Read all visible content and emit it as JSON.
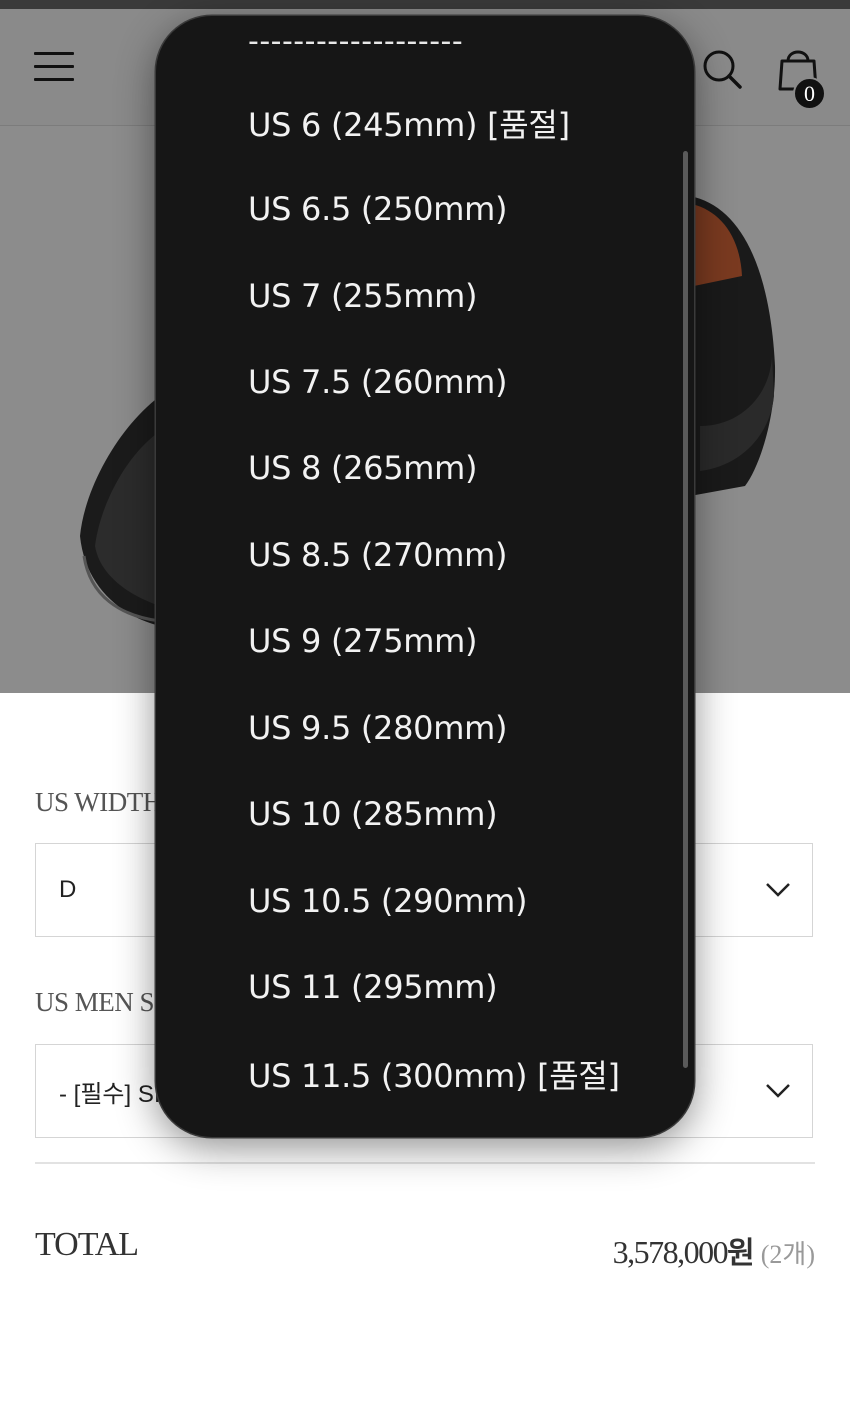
{
  "header": {
    "cart_count": "0"
  },
  "options": {
    "width": {
      "label": "US WIDTH",
      "value": "D"
    },
    "size": {
      "label": "US MEN SIZE",
      "value": "- [필수] SIZE"
    }
  },
  "total": {
    "label": "TOTAL",
    "amount": "3,578,000",
    "currency": "원",
    "quantity": "(2개)"
  },
  "picker": {
    "separator": "-------------------",
    "items": [
      "US 6 (245mm) [품절]",
      "US 6.5 (250mm)",
      "US 7 (255mm)",
      "US 7.5 (260mm)",
      "US 8 (265mm)",
      "US 8.5 (270mm)",
      "US 9 (275mm)",
      "US 9.5 (280mm)",
      "US 10 (285mm)",
      "US 10.5 (290mm)",
      "US 11 (295mm)",
      "US 11.5 (300mm) [품절]"
    ]
  },
  "icons": [
    "menu-icon",
    "search-icon",
    "shopping-bag-icon",
    "chevron-down-icon"
  ],
  "colors": {
    "picker_background": "#161616",
    "overlay_dim": "#8a8a8a",
    "text_dark": "#333333"
  }
}
